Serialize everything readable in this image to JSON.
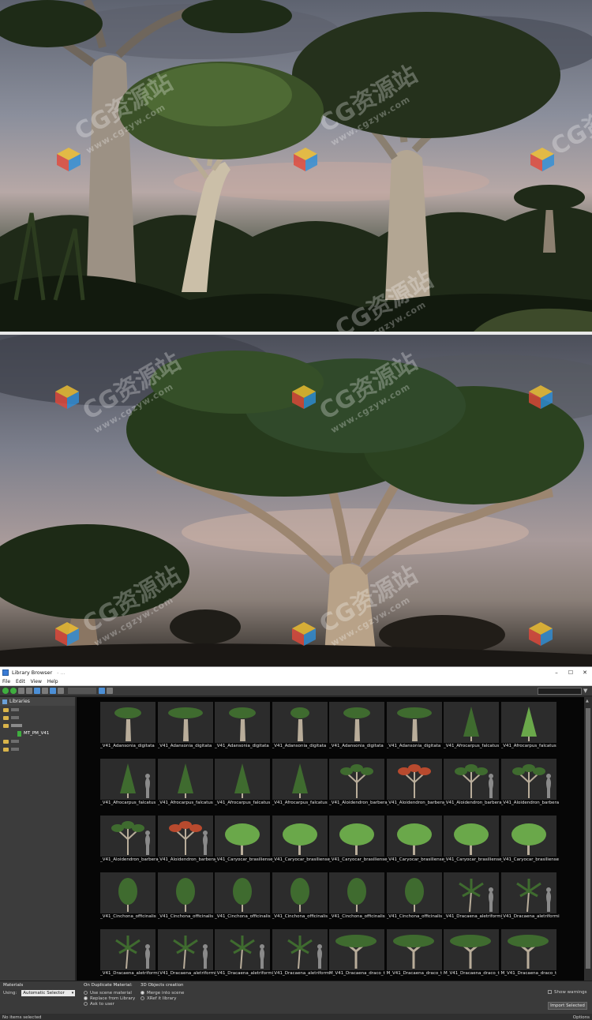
{
  "watermark": {
    "brand": "CG资源站",
    "url": "www.cgzyw.com"
  },
  "window": {
    "title": "Library Browser",
    "title_path_blur": "- ... ",
    "controls": [
      "–",
      "☐",
      "✕"
    ]
  },
  "menu": [
    "File",
    "Edit",
    "View",
    "Help"
  ],
  "sidebar": {
    "header": "Libraries",
    "selected_item": "MT_PM_V41"
  },
  "assets": [
    {
      "label": "_V41_Adansonia_digitata",
      "kind": "baobab"
    },
    {
      "label": "_V41_Adansonia_digitata",
      "kind": "baobab-wide"
    },
    {
      "label": "_V41_Adansonia_digitata",
      "kind": "baobab"
    },
    {
      "label": "_V41_Adansonia_digitata",
      "kind": "baobab-thin"
    },
    {
      "label": "_V41_Adansonia_digitata",
      "kind": "baobab-tall"
    },
    {
      "label": "_V41_Adansonia_digitata",
      "kind": "baobab-wide"
    },
    {
      "label": "_V41_Afrocarpus_falcatus",
      "kind": "conifer"
    },
    {
      "label": "_V41_Afrocarpus_falcatus",
      "kind": "conifer-bright"
    },
    {
      "label": "_V41_Afrocarpus_falcatus",
      "kind": "conifer-person"
    },
    {
      "label": "_V41_Afrocarpus_falcatus",
      "kind": "conifer-small"
    },
    {
      "label": "_V41_Afrocarpus_falcatus",
      "kind": "conifer"
    },
    {
      "label": "_V41_Afrocarpus_falcatus",
      "kind": "conifer"
    },
    {
      "label": "_V41_Aloidendron_barbera",
      "kind": "aloe"
    },
    {
      "label": "_V41_Aloidendron_barbera",
      "kind": "aloe-red"
    },
    {
      "label": "_V41_Aloidendron_barbera",
      "kind": "aloe-person"
    },
    {
      "label": "_V41_Aloidendron_barbera",
      "kind": "aloe-person"
    },
    {
      "label": "_V41_Aloidendron_barbera",
      "kind": "aloe-person"
    },
    {
      "label": "_V41_Aloidendron_barbera",
      "kind": "aloe-red-person"
    },
    {
      "label": "_V41_Caryocar_brasiliense",
      "kind": "round"
    },
    {
      "label": "_V41_Caryocar_brasiliense",
      "kind": "round"
    },
    {
      "label": "_V41_Caryocar_brasiliense",
      "kind": "round"
    },
    {
      "label": "_V41_Caryocar_brasiliense",
      "kind": "round"
    },
    {
      "label": "_V41_Caryocar_brasiliense",
      "kind": "round"
    },
    {
      "label": "_V41_Caryocar_brasiliense",
      "kind": "round"
    },
    {
      "label": "_V41_Cinchona_officinalis",
      "kind": "bush"
    },
    {
      "label": "_V41_Cinchona_officinalis",
      "kind": "bush"
    },
    {
      "label": "_V41_Cinchona_officinalis",
      "kind": "bush"
    },
    {
      "label": "_V41_Cinchona_officinalis",
      "kind": "bush"
    },
    {
      "label": "_V41_Cinchona_officinalis",
      "kind": "bush"
    },
    {
      "label": "_V41_Cinchona_officinalis",
      "kind": "bush"
    },
    {
      "label": "_V41_Dracaena_aletriformi",
      "kind": "palm-person"
    },
    {
      "label": "_V41_Dracaena_aletriformi",
      "kind": "palm-person"
    },
    {
      "label": "_V41_Dracaena_aletriformi",
      "kind": "palm-person"
    },
    {
      "label": "_V41_Dracaena_aletriformi",
      "kind": "palm-person"
    },
    {
      "label": "_V41_Dracaena_aletriformi",
      "kind": "palm-person"
    },
    {
      "label": "_V41_Dracaena_aletriformi",
      "kind": "palm-person"
    },
    {
      "label": "M_V41_Dracaena_draco_t",
      "kind": "dragon"
    },
    {
      "label": "M_V41_Dracaena_draco_t",
      "kind": "dragon"
    },
    {
      "label": "M_V41_Dracaena_draco_t",
      "kind": "dragon"
    },
    {
      "label": "M_V41_Dracaena_draco_t",
      "kind": "dragon"
    }
  ],
  "options": {
    "materials_title": "Materials",
    "using_label": "Using:",
    "using_value": "Automatic Selector",
    "dup_title": "On Duplicate Material:",
    "dup_options": [
      "Use scene material",
      "Replace from Library",
      "Ask to user"
    ],
    "dup_selected": 1,
    "creation_title": "3D Objects creation",
    "creation_options": [
      "Merge into scene",
      "XRef it library"
    ],
    "creation_selected": 0,
    "show_warnings": "Show warnings",
    "import_button": "Import Selected"
  },
  "status": {
    "left": "No items selected",
    "right": "Options"
  },
  "colors": {
    "foliage": "#3f6b2f",
    "foliage_light": "#6aa84a",
    "trunk": "#b9ad9a",
    "person": "#8a8a8a",
    "aloe_red": "#b84a2e"
  }
}
